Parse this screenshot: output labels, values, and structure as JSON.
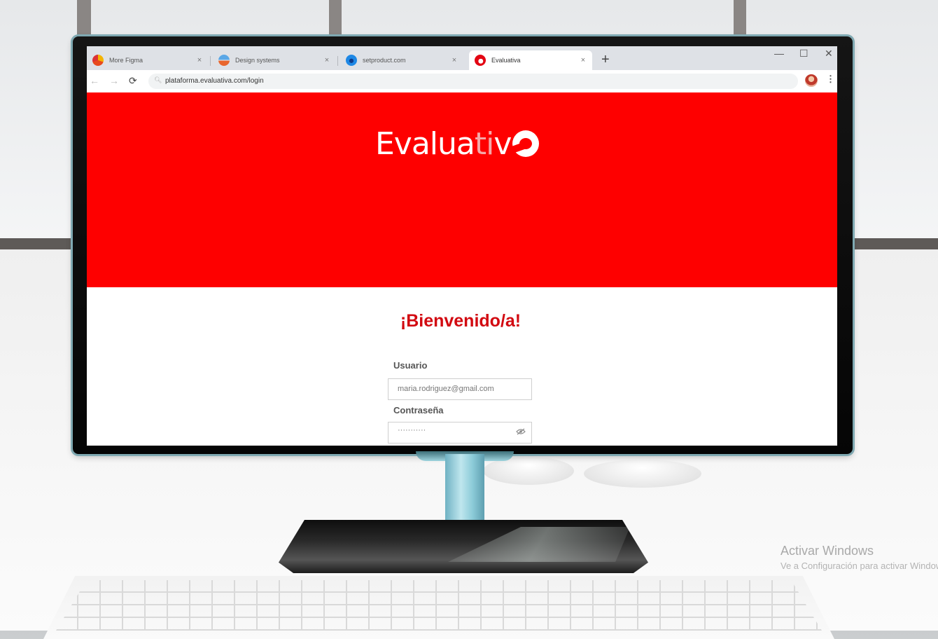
{
  "browser": {
    "tabs": [
      {
        "title": "More Figma",
        "favicon": "figma-pie-icon",
        "active": false
      },
      {
        "title": "Design systems",
        "favicon": "globe-icon",
        "active": false
      },
      {
        "title": "setproduct.com",
        "favicon": "setproduct-icon",
        "active": false
      },
      {
        "title": "Evaluativa",
        "favicon": "evaluativa-icon",
        "active": true
      }
    ],
    "tab_close": "×",
    "new_tab": "+",
    "window_controls": {
      "minimize": "—",
      "maximize": "☐",
      "close": "✕"
    },
    "nav": {
      "back": "←",
      "forward": "→",
      "reload": "⟳"
    },
    "url": "plataforma.evaluativa.com/login",
    "bookmark": "☆",
    "menu": "⋮"
  },
  "page": {
    "brand_color": "#fe0000",
    "logo": {
      "main": "Evalua",
      "accent": "ti",
      "tail": "v"
    },
    "welcome": "¡Bienvenido/a!",
    "form": {
      "username_label": "Usuario",
      "username_value": "maria.rodriguez@gmail.com",
      "password_label": "Contraseña",
      "password_value": "···········",
      "visibility_toggle": "hide-password-icon"
    }
  },
  "watermark": {
    "title": "Activar Windows",
    "subtitle": "Ve a Configuración para activar Windows."
  }
}
